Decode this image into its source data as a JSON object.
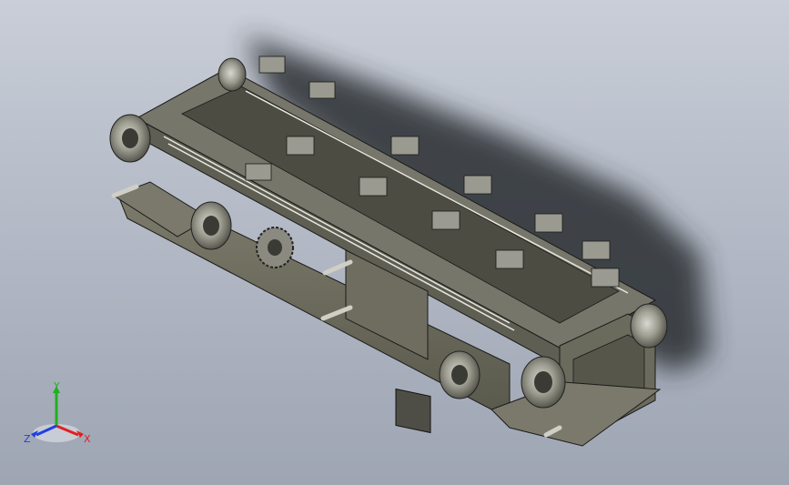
{
  "view": {
    "background_top": "#c9ced8",
    "background_bottom": "#9ea5b3",
    "model_color": "#6b6b5c",
    "edge_color": "#1a1a1a"
  },
  "triad": {
    "x_label": "X",
    "y_label": "Y",
    "z_label": "Z",
    "x_color": "#e02020",
    "y_color": "#20b020",
    "z_color": "#2040e0"
  }
}
